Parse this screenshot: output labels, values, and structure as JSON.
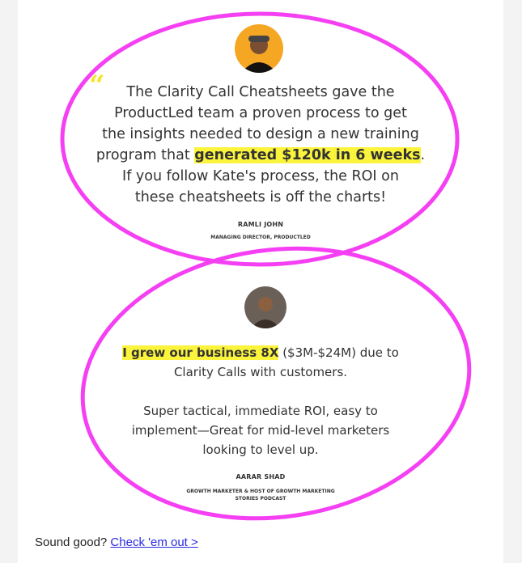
{
  "testimonials": [
    {
      "pre": "The Clarity Call Cheatsheets gave the",
      "l2": "ProductLed team a proven process to get",
      "l3": "the insights needed to design a new training",
      "l4pre": "program that ",
      "highlight": "generated $120k in 6 weeks",
      "l4post": ".",
      "l5": "If you follow Kate's process, the ROI on",
      "l6": "these cheatsheets is off the charts!",
      "name": "RAMLI JOHN",
      "title": "MANAGING DIRECTOR, PRODUCTLED"
    },
    {
      "highlight": "I grew our business 8X",
      "l1post": " ($3M-$24M) due to",
      "l2": "Clarity Calls with customers.",
      "l3": "Super tactical, immediate ROI, easy to",
      "l4": "implement—Great for mid-level marketers",
      "l5": "looking to level up.",
      "name": "AARAR SHAD",
      "title1": "GROWTH MARKETER & HOST OF GROWTH MARKETING",
      "title2": "STORIES PODCAST"
    }
  ],
  "quote_mark": "“",
  "footer": {
    "text": "Sound good? ",
    "link": "Check 'em out >"
  },
  "colors": {
    "annotation": "#f53ff3",
    "highlight": "#fbf43c",
    "link": "#2a2ae0"
  }
}
